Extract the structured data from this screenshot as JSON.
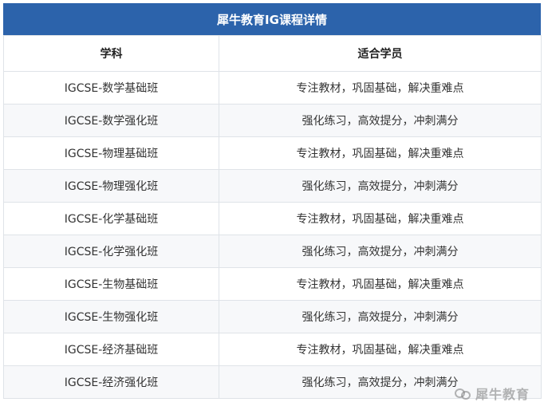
{
  "title": "犀牛教育IG课程详情",
  "table": {
    "headers": [
      "学科",
      "适合学员"
    ],
    "rows": [
      [
        "IGCSE-数学基础班",
        "专注教材，巩固基础，解决重难点"
      ],
      [
        "IGCSE-数学强化班",
        "强化练习，高效提分，冲刺满分"
      ],
      [
        "IGCSE-物理基础班",
        "专注教材，巩固基础，解决重难点"
      ],
      [
        "IGCSE-物理强化班",
        "强化练习，高效提分，冲刺满分"
      ],
      [
        "IGCSE-化学基础班",
        "专注教材，巩固基础，解决重难点"
      ],
      [
        "IGCSE-化学强化班",
        "强化练习，高效提分，冲刺满分"
      ],
      [
        "IGCSE-生物基础班",
        "专注教材，巩固基础，解决重难点"
      ],
      [
        "IGCSE-生物强化班",
        "强化练习，高效提分，冲刺满分"
      ],
      [
        "IGCSE-经济基础班",
        "专注教材，巩固基础，解决重难点"
      ],
      [
        "IGCSE-经济强化班",
        "强化练习，高效提分，冲刺满分"
      ]
    ]
  },
  "watermark": {
    "text": "犀牛教育",
    "icon": "wechat-icon"
  },
  "colors": {
    "header_bg": "#2c63ab",
    "header_text": "#ffffff",
    "border": "#dfe3e8"
  }
}
